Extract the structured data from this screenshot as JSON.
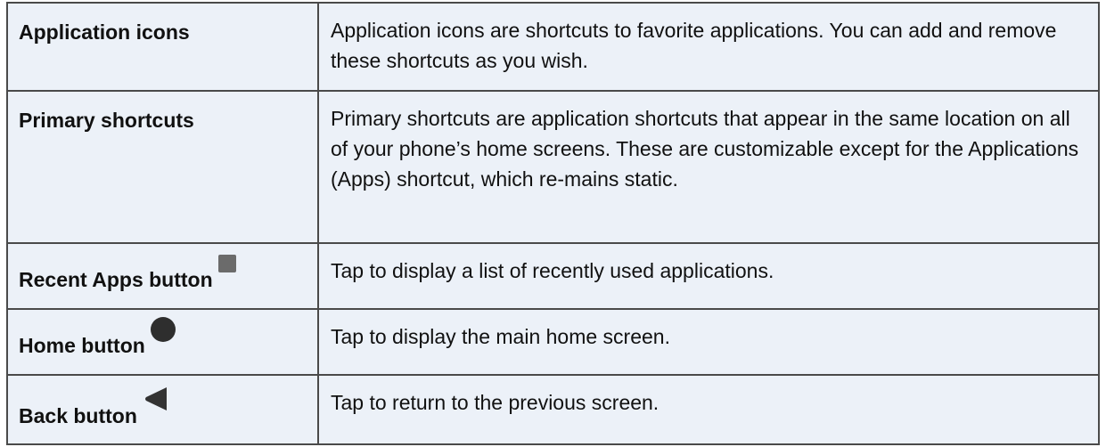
{
  "rows": [
    {
      "term": "Application icons",
      "description": "Application icons are shortcuts to favorite applications. You can add and remove these shortcuts as you wish."
    },
    {
      "term": "Primary shortcuts",
      "description": "Primary shortcuts are application shortcuts that appear in the same location on all of your phone’s home screens. These are customizable except for the Applications (Apps) shortcut, which re-mains static."
    },
    {
      "term": "Recent Apps button",
      "icon": "recent-apps-square-icon",
      "description": "Tap to display a list of recently used applications."
    },
    {
      "term": "Home button",
      "icon": "home-circle-icon",
      "description": "Tap to display the main home screen."
    },
    {
      "term": "Back button",
      "icon": "back-triangle-icon",
      "description": "Tap to return to the previous screen."
    }
  ],
  "colors": {
    "cell_background": "#ecf1f8",
    "border": "#4a4a4a",
    "text": "#111111",
    "recent_apps_icon": "#6b6b6b",
    "home_icon": "#2e2e2e",
    "back_icon": "#333333"
  }
}
